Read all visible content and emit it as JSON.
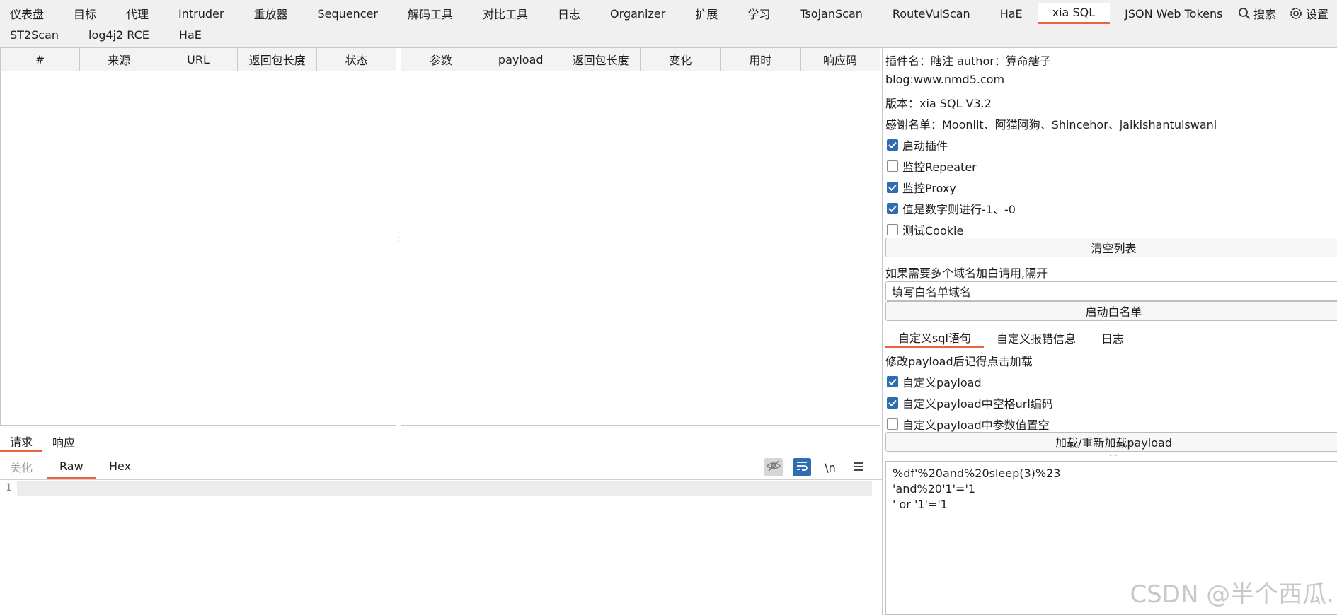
{
  "top_tabs_row1": [
    "仪表盘",
    "目标",
    "代理",
    "Intruder",
    "重放器",
    "Sequencer",
    "解码工具",
    "对比工具",
    "日志",
    "Organizer",
    "扩展",
    "学习",
    "TsojanScan",
    "RouteVulScan",
    "HaE",
    "xia SQL",
    "JSON Web Tokens"
  ],
  "top_tabs_row2": [
    "ST2Scan",
    "log4j2 RCE",
    "HaE"
  ],
  "active_top_tab": "xia SQL",
  "toolbar": {
    "search_label": "搜索",
    "settings_label": "设置"
  },
  "table_left": {
    "columns": [
      "#",
      "来源",
      "URL",
      "返回包长度",
      "状态"
    ]
  },
  "table_right": {
    "columns": [
      "参数",
      "payload",
      "返回包长度",
      "变化",
      "用时",
      "响应码"
    ]
  },
  "req_tabs": [
    "请求",
    "响应"
  ],
  "view_tabs": [
    "美化",
    "Raw",
    "Hex"
  ],
  "editor": {
    "newline_label": "\\n",
    "line_number": "1"
  },
  "plugin_info": {
    "name_line": "插件名：瞎注 author：算命縖子",
    "blog_line": "blog:www.nmd5.com",
    "version_line": "版本：xia SQL V3.2",
    "thanks_line": "感谢名单：Moonlit、阿猫阿狗、Shincehor、jaikishantulswani"
  },
  "options": [
    {
      "label": "启动插件",
      "checked": true
    },
    {
      "label": "监控Repeater",
      "checked": false
    },
    {
      "label": "监控Proxy",
      "checked": true
    },
    {
      "label": "值是数字则进行-1、-0",
      "checked": true
    },
    {
      "label": "测试Cookie",
      "checked": false
    }
  ],
  "clear_button": "清空列表",
  "whitelist": {
    "hint": "如果需要多个域名加白请用,隔开",
    "value": "填写白名单域名",
    "button": "启动白名单"
  },
  "sub_tabs": [
    "自定义sql语句",
    "自定义报错信息",
    "日志"
  ],
  "payload_section": {
    "hint": "修改payload后记得点击加载",
    "options": [
      {
        "label": "自定义payload",
        "checked": true
      },
      {
        "label": "自定义payload中空格url编码",
        "checked": true
      },
      {
        "label": "自定义payload中参数值置空",
        "checked": false
      }
    ],
    "load_button": "加载/重新加载payload",
    "lines": [
      "%df'%20and%20sleep(3)%23",
      "'and%20'1'='1",
      "' or '1'='1"
    ]
  },
  "watermark": "CSDN @半个西瓜."
}
